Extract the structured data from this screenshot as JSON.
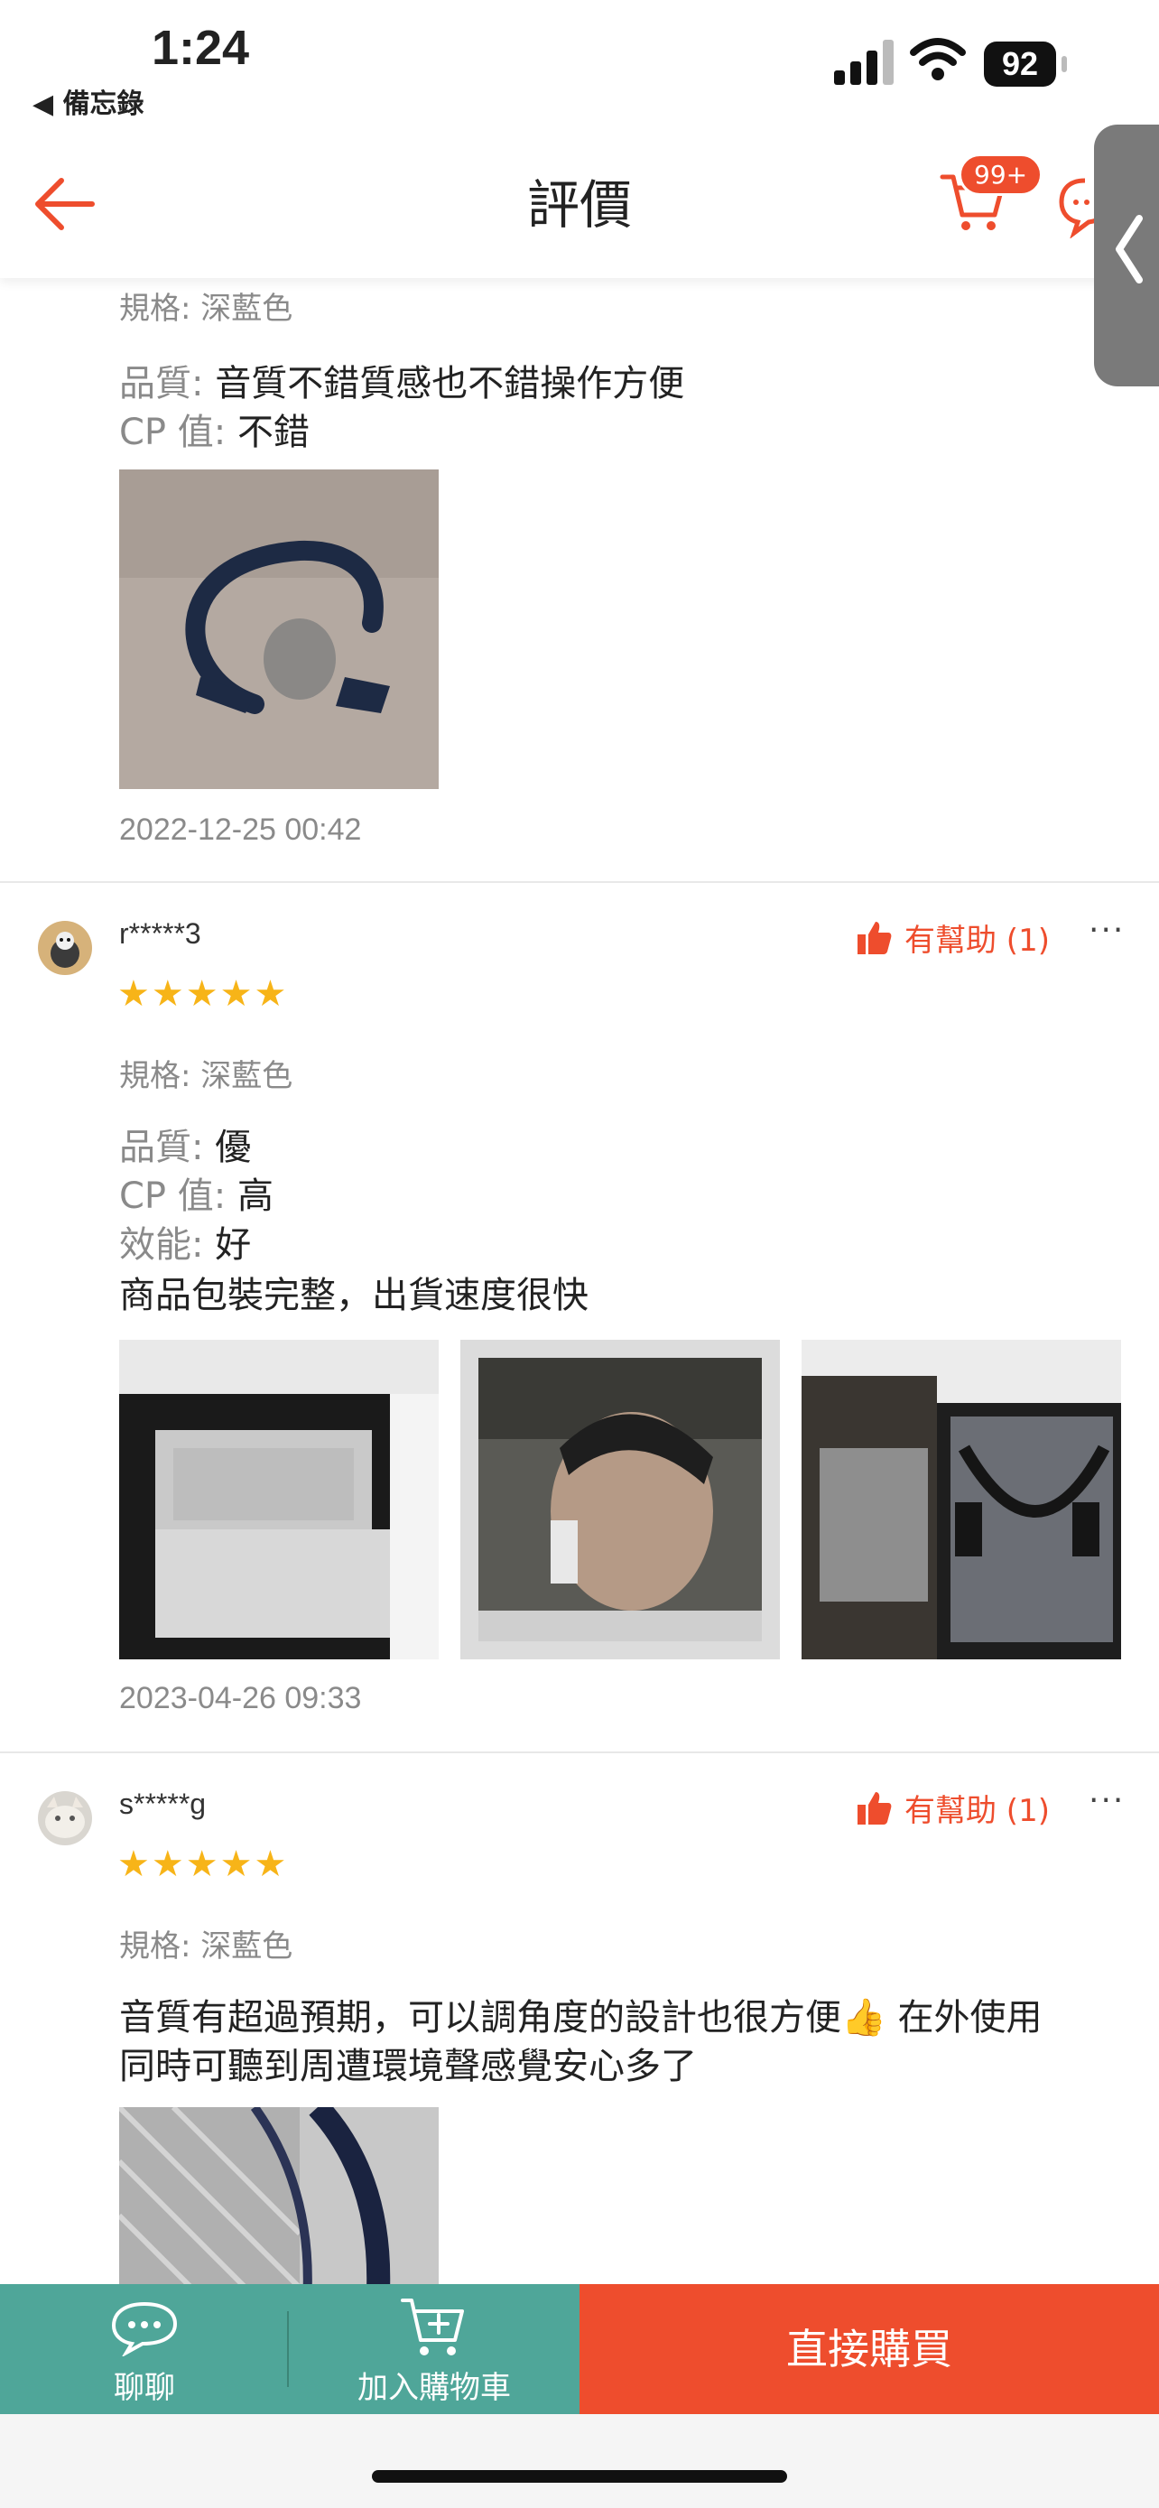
{
  "status_bar": {
    "time": "1:24",
    "back_app": "◀ 備忘錄",
    "battery": "92"
  },
  "header": {
    "title": "評價",
    "cart_badge": "99+"
  },
  "reviews": [
    {
      "spec": "規格: 深藍色",
      "lines": [
        {
          "key": "品質:",
          "value": "音質不錯質感也不錯操作方便"
        },
        {
          "key": "CP 值:",
          "value": "不錯"
        }
      ],
      "date": "2022-12-25 00:42"
    },
    {
      "username": "r*****3",
      "stars": "★★★★★",
      "helpful": "有幫助 (1)",
      "spec": "規格: 深藍色",
      "lines": [
        {
          "key": "品質:",
          "value": "優"
        },
        {
          "key": "CP 值:",
          "value": "高"
        },
        {
          "key": "效能:",
          "value": "好"
        }
      ],
      "comment": "商品包裝完整，出貨速度很快",
      "date": "2023-04-26 09:33"
    },
    {
      "username": "s*****g",
      "stars": "★★★★★",
      "helpful": "有幫助 (1)",
      "spec": "規格: 深藍色",
      "comment_line1": "音質有超過預期，可以調角度的設計也很方便👍 在外使用",
      "comment_line2": "同時可聽到周遭環境聲感覺安心多了"
    }
  ],
  "more_glyph": "···",
  "bottom_bar": {
    "chat_label": "聊聊",
    "cart_label": "加入購物車",
    "buy_label": "直接購買"
  },
  "colors": {
    "brand": "#ee4d2d",
    "teal": "#4fa699",
    "star": "#f7b418"
  },
  "icons": [
    "back-arrow-icon",
    "cart-icon",
    "chat-icon",
    "thumbs-up-icon",
    "more-icon",
    "side-tab-chevron-icon",
    "add-to-cart-icon"
  ]
}
